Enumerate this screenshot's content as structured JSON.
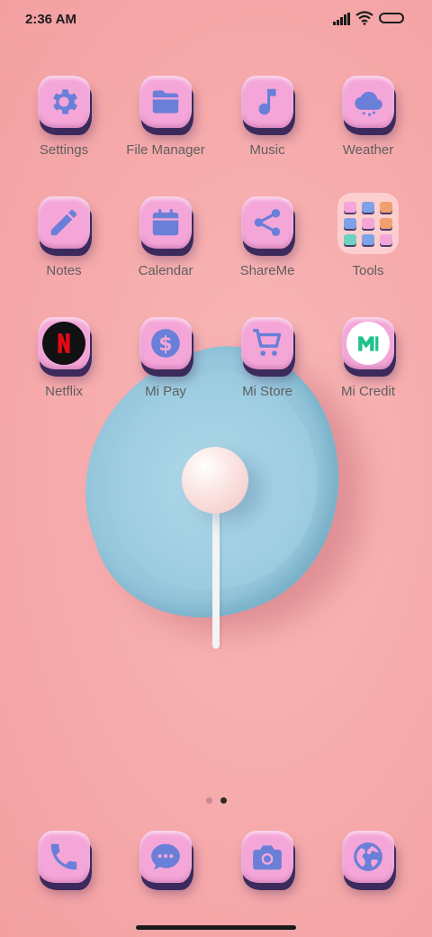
{
  "status_bar": {
    "time": "2:36 AM"
  },
  "home_grid": [
    {
      "label": "Settings",
      "icon": "gear-icon"
    },
    {
      "label": "File Manager",
      "icon": "folder-icon"
    },
    {
      "label": "Music",
      "icon": "music-note-icon"
    },
    {
      "label": "Weather",
      "icon": "cloud-icon"
    },
    {
      "label": "Notes",
      "icon": "pencil-icon"
    },
    {
      "label": "Calendar",
      "icon": "calendar-icon"
    },
    {
      "label": "ShareMe",
      "icon": "share-icon"
    },
    {
      "label": "Tools",
      "icon": "folder-grid-icon"
    },
    {
      "label": "Netflix",
      "icon": "netflix-logo-icon"
    },
    {
      "label": "Mi Pay",
      "icon": "dollar-icon"
    },
    {
      "label": "Mi Store",
      "icon": "cart-icon"
    },
    {
      "label": "Mi Credit",
      "icon": "mi-logo-icon"
    }
  ],
  "dock": [
    {
      "icon": "phone-icon"
    },
    {
      "icon": "message-icon"
    },
    {
      "icon": "camera-icon"
    },
    {
      "icon": "globe-icon"
    }
  ],
  "page_indicator": {
    "total": 2,
    "current": 2
  },
  "colors": {
    "icon_bg": "#f4a6d8",
    "glyph": "#6a7fd8",
    "wallpaper": "#f6aaab"
  }
}
